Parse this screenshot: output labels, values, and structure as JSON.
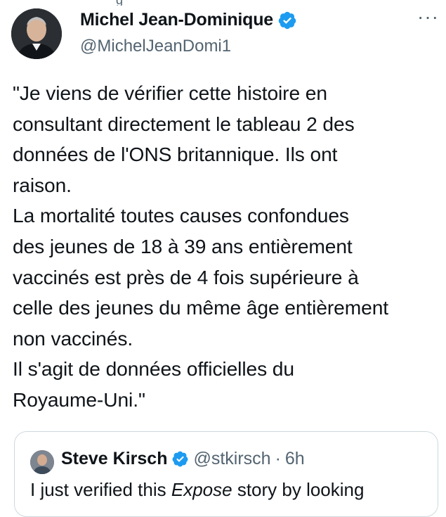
{
  "author": {
    "display_name": "Michel Jean-Dominique",
    "handle": "@MichelJeanDomi1",
    "verified_badge_icon": "verified-badge-icon",
    "avatar_icon": "profile-photo"
  },
  "header_sliver_text": "g",
  "more_menu_label": "···",
  "tweet": {
    "text": "\"Je viens de vérifier cette histoire en\nconsultant directement le tableau 2 des\ndonnées de l'ONS britannique. Ils ont\nraison.\nLa mortalité toutes causes confondues\ndes jeunes de 18 à 39 ans entièrement\nvaccinés est près de 4 fois supérieure à\ncelle des jeunes du même âge entièrement\nnon vaccinés.\nIl s'agit de données officielles du\nRoyaume-Uni.\""
  },
  "quoted_tweet": {
    "display_name": "Steve Kirsch",
    "handle": "@stkirsch",
    "separator": "·",
    "time": "6h",
    "text_before": "I just verified this ",
    "text_italic": "Expose",
    "text_after": " story by looking"
  },
  "colors": {
    "text_primary": "#0f1419",
    "text_secondary": "#536471",
    "verified_blue": "#1d9bf0",
    "border": "#cfd9de"
  }
}
